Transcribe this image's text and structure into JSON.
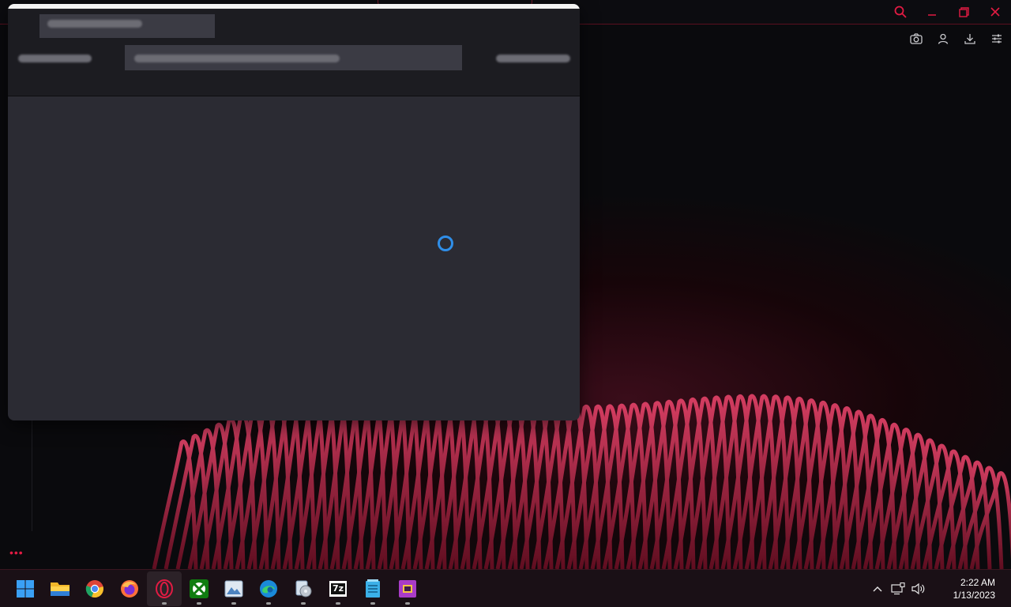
{
  "browser": {
    "window_controls": {
      "search_icon": "search-icon",
      "minimize_icon": "minimize-icon",
      "restore_icon": "restore-icon",
      "close_icon": "close-icon"
    },
    "toolbar": [
      "camera-icon",
      "user-icon",
      "download-icon",
      "settings-icon"
    ],
    "accent_color": "#e21b43",
    "more_label": "•••"
  },
  "dialog": {
    "state": "loading",
    "spinner_color": "#2f8ee8"
  },
  "taskbar": {
    "apps": [
      {
        "name": "start-button",
        "icon": "windows-logo-icon",
        "running": false
      },
      {
        "name": "file-explorer",
        "icon": "folder-icon",
        "running": false
      },
      {
        "name": "chrome",
        "icon": "chrome-icon",
        "running": false
      },
      {
        "name": "firefox",
        "icon": "firefox-icon",
        "running": false
      },
      {
        "name": "opera-gx",
        "icon": "opera-icon",
        "running": true
      },
      {
        "name": "xbox",
        "icon": "xbox-icon",
        "running": true
      },
      {
        "name": "photos",
        "icon": "photos-icon",
        "running": true
      },
      {
        "name": "edge",
        "icon": "edge-icon",
        "running": true
      },
      {
        "name": "media-app",
        "icon": "media-icon",
        "running": true
      },
      {
        "name": "7zip",
        "icon": "7zip-icon",
        "running": true
      },
      {
        "name": "notepad",
        "icon": "notepad-icon",
        "running": true
      },
      {
        "name": "snipping-tool",
        "icon": "snip-icon",
        "running": true
      }
    ],
    "sevenzip_label": "7z",
    "tray": {
      "chevron_icon": "chevron-up-icon",
      "network_icon": "network-icon",
      "volume_icon": "volume-icon"
    },
    "time": "2:22 AM",
    "date": "1/13/2023"
  }
}
